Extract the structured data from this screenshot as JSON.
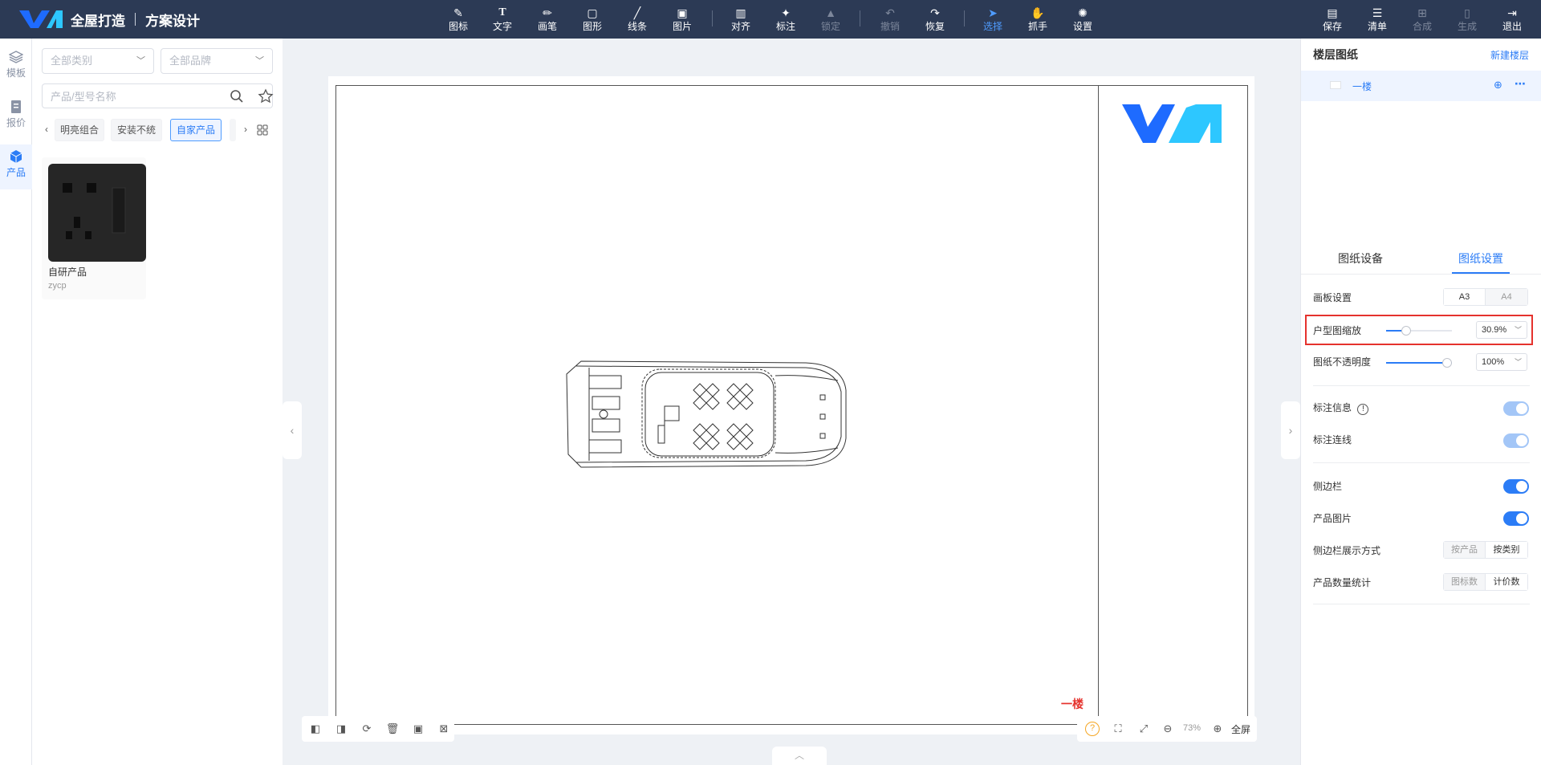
{
  "header": {
    "brand": "全屋打造",
    "subtitle": "方案设计"
  },
  "toolbar": {
    "tools": [
      {
        "label": "图标",
        "icon": "icon-icon"
      },
      {
        "label": "文字",
        "icon": "text-icon"
      },
      {
        "label": "画笔",
        "icon": "brush-icon"
      },
      {
        "label": "图形",
        "icon": "shape-icon"
      },
      {
        "label": "线条",
        "icon": "line-icon"
      },
      {
        "label": "图片",
        "icon": "image-icon"
      },
      {
        "label": "对齐",
        "icon": "align-icon"
      },
      {
        "label": "标注",
        "icon": "pin-icon"
      },
      {
        "label": "锁定",
        "icon": "lock-icon"
      },
      {
        "label": "撤销",
        "icon": "undo-icon"
      },
      {
        "label": "恢复",
        "icon": "redo-icon"
      },
      {
        "label": "选择",
        "icon": "cursor-icon"
      },
      {
        "label": "抓手",
        "icon": "hand-icon"
      },
      {
        "label": "设置",
        "icon": "gear-icon"
      }
    ],
    "actions": [
      {
        "label": "保存",
        "icon": "save-icon"
      },
      {
        "label": "清单",
        "icon": "list-icon"
      },
      {
        "label": "合成",
        "icon": "compose-icon"
      },
      {
        "label": "生成",
        "icon": "generate-icon"
      },
      {
        "label": "退出",
        "icon": "exit-icon"
      }
    ]
  },
  "leftnav": [
    {
      "label": "模板",
      "icon": "layers-icon"
    },
    {
      "label": "报价",
      "icon": "quote-icon"
    },
    {
      "label": "产品",
      "icon": "cube-icon",
      "active": true
    }
  ],
  "filters": {
    "category": "全部类别",
    "brand": "全部品牌",
    "search_placeholder": "产品/型号名称"
  },
  "chips": [
    "明亮组合",
    "安装不统",
    "自家产品"
  ],
  "product": {
    "name": "自研产品",
    "code": "zycp"
  },
  "canvas": {
    "floor_label": "一楼",
    "zoom": "73%",
    "fullscreen": "全屏"
  },
  "right": {
    "title": "楼层图纸",
    "new_floor": "新建楼层",
    "floor": "一楼",
    "tabs": [
      "图纸设备",
      "图纸设置"
    ],
    "active_tab": "图纸设置",
    "board_label": "画板设置",
    "board_options": [
      "A3",
      "A4"
    ],
    "scale_label": "户型图缩放",
    "scale_value": "30.9%",
    "scale_fraction": 0.309,
    "opacity_label": "图纸不透明度",
    "opacity_value": "100%",
    "opacity_fraction": 1.0,
    "annotation_info": "标注信息",
    "annotation_line": "标注连线",
    "sidebar": "侧边栏",
    "product_image": "产品图片",
    "sidebar_mode_label": "侧边栏展示方式",
    "sidebar_mode_options": [
      "按产品",
      "按类别"
    ],
    "count_label": "产品数量统计",
    "count_options": [
      "图标数",
      "计价数"
    ]
  },
  "colors": {
    "topbar": "#2c3a55",
    "accent": "#2b7cf6",
    "highlight_box": "#e5322d"
  }
}
